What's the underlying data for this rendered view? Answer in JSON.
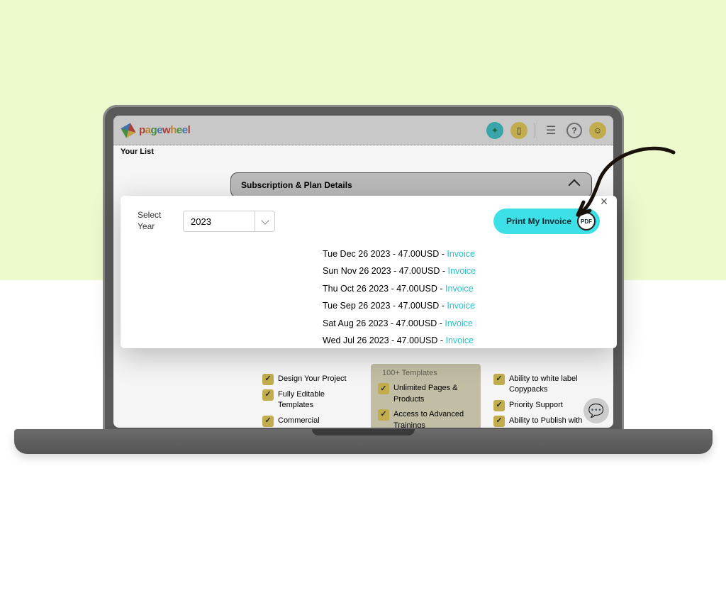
{
  "header": {
    "brand_p": "p",
    "brand_a": "a",
    "brand_g": "g",
    "brand_e": "e",
    "brand_w": "w",
    "brand_h": "h",
    "brand_e2": "e",
    "brand_e3": "e",
    "brand_l": "l",
    "your_list": "Your List"
  },
  "panel": {
    "title": "Subscription & Plan Details"
  },
  "plans": {
    "col1": {
      "f1": "Design Your Project",
      "f2": "Fully Editable Templates",
      "f3": "Commercial"
    },
    "col2": {
      "f0": "100+ Templates",
      "f1": "Unlimited Pages & Products",
      "f2": "Access to Advanced Trainings"
    },
    "col3": {
      "f1": "Ability to white label Copypacks",
      "f2": "Priority Support",
      "f3": "Ability to Publish with POD"
    }
  },
  "modal": {
    "select_label": "Select Year",
    "year": "2023",
    "print_label": "Print My Invoice",
    "pdf_badge": "PDF",
    "invoices": [
      {
        "text": "Tue Dec 26 2023 - 47.00USD -",
        "link": "Invoice"
      },
      {
        "text": "Sun Nov 26 2023 - 47.00USD -",
        "link": "Invoice"
      },
      {
        "text": "Thu Oct 26 2023 - 47.00USD -",
        "link": "Invoice"
      },
      {
        "text": "Tue Sep 26 2023 - 47.00USD -",
        "link": "Invoice"
      },
      {
        "text": "Sat Aug 26 2023 - 47.00USD -",
        "link": "Invoice"
      },
      {
        "text": "Wed Jul 26 2023 - 47.00USD -",
        "link": "Invoice"
      }
    ]
  }
}
